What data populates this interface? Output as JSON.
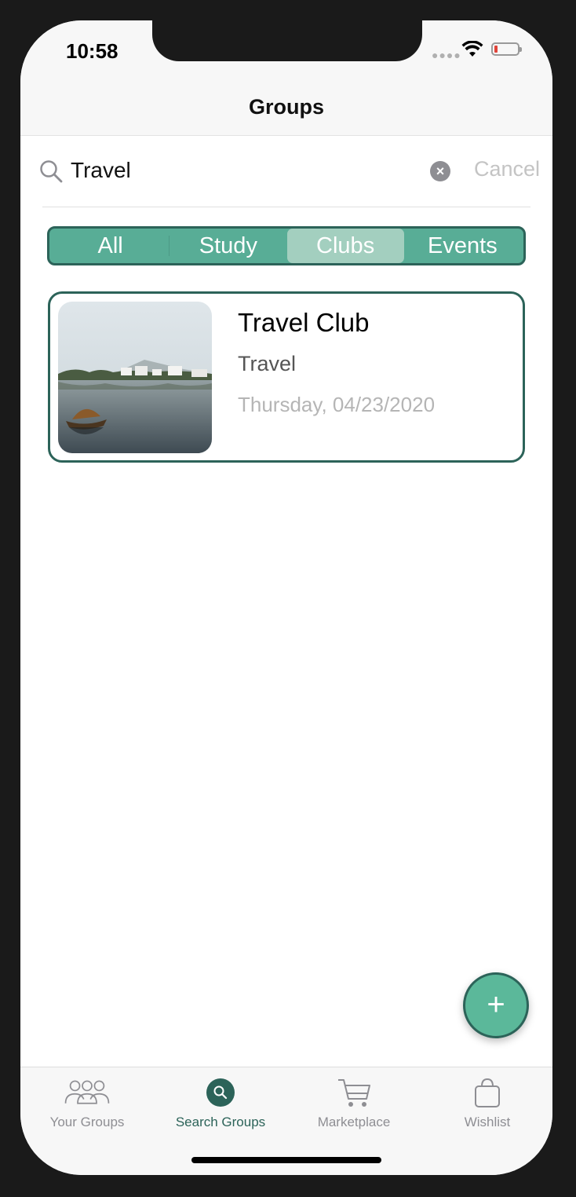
{
  "status_bar": {
    "time": "10:58"
  },
  "nav": {
    "title": "Groups"
  },
  "search": {
    "value": "Travel",
    "cancel_label": "Cancel"
  },
  "segments": [
    {
      "label": "All",
      "selected": false
    },
    {
      "label": "Study",
      "selected": false
    },
    {
      "label": "Clubs",
      "selected": true
    },
    {
      "label": "Events",
      "selected": false
    }
  ],
  "results": [
    {
      "title": "Travel Club",
      "category": "Travel",
      "date": "Thursday, 04/23/2020",
      "image_icon": "lake-boat-photo"
    }
  ],
  "fab": {
    "label": "+",
    "icon": "plus-icon"
  },
  "tab_bar": {
    "items": [
      {
        "label": "Your Groups",
        "icon": "people-icon",
        "active": false
      },
      {
        "label": "Search Groups",
        "icon": "search-circle-icon",
        "active": true
      },
      {
        "label": "Marketplace",
        "icon": "cart-icon",
        "active": false
      },
      {
        "label": "Wishlist",
        "icon": "bag-icon",
        "active": false
      }
    ]
  },
  "colors": {
    "accent": "#58ad96",
    "accent_dark": "#2c6359",
    "segment_selected": "#a3cfbf",
    "fab": "#5bb89a"
  }
}
